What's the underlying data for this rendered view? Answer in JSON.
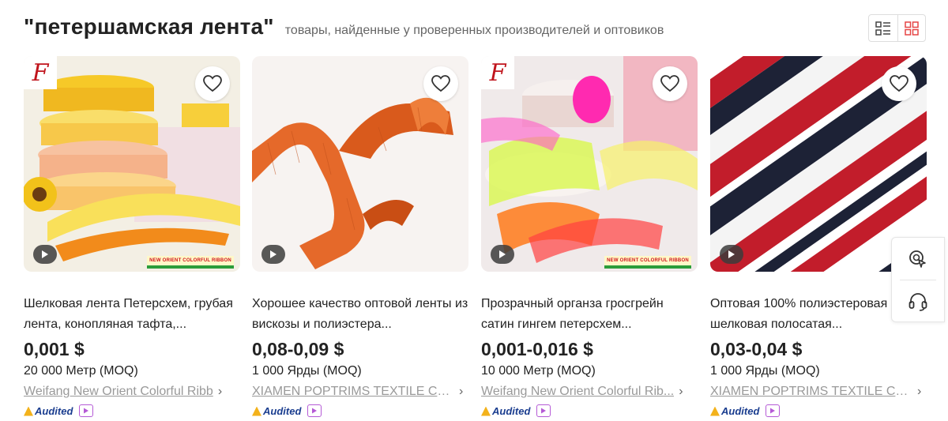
{
  "header": {
    "query": "\"петершамская лента\"",
    "subtitle": "товары, найденные у проверенных производителей и оптовиков"
  },
  "view_toggle": {
    "list_icon": "list-view-icon",
    "grid_icon": "grid-view-icon",
    "active": "grid",
    "active_color": "#e64545"
  },
  "products": [
    {
      "title": "Шелковая лента Петерсхем, грубая лента, конопляная тафта,...",
      "price": "0,001 $",
      "moq": "20 000 Метр (MOQ)",
      "supplier": "Weifang New Orient Colorful Ribb",
      "badge": "Audited",
      "banner": "NEW ORIENT COLORFUL RIBBON",
      "logo": "F"
    },
    {
      "title": "Хорошее качество оптовой ленты из вискозы и полиэстера...",
      "price": "0,08-0,09 $",
      "moq": "1 000 Ярды (MOQ)",
      "supplier": "XIAMEN POPTRIMS TEXTILE CO...",
      "badge": "Audited"
    },
    {
      "title": "Прозрачный органза гросгрейн сатин гингем петерсхем...",
      "price": "0,001-0,016 $",
      "moq": "10 000 Метр (MOQ)",
      "supplier": "Weifang New Orient Colorful Rib...",
      "badge": "Audited",
      "banner": "NEW ORIENT COLORFUL RIBBON",
      "logo": "F"
    },
    {
      "title": "Оптовая 100% полиэстеровая шелковая полосатая...",
      "price": "0,03-0,04 $",
      "moq": "1 000 Ярды (MOQ)",
      "supplier": "XIAMEN POPTRIMS TEXTILE CO...",
      "badge": "Audited"
    }
  ],
  "floating_panel": {
    "top_icon": "image-search-icon",
    "bottom_icon": "customer-service-headset-icon"
  }
}
